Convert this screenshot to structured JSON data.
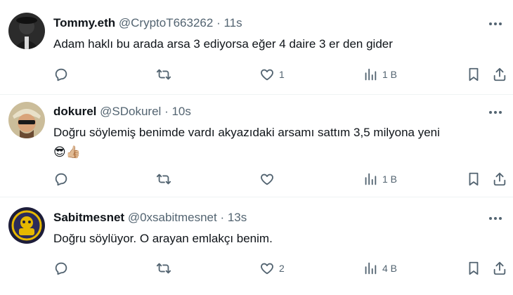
{
  "tweets": [
    {
      "name": "Tommy.eth",
      "handle": "@CryptoT663262",
      "separator": "·",
      "time": "11s",
      "text": "Adam haklı bu arada arsa  3 ediyorsa eğer 4 daire  3 er den gider",
      "emoji": "",
      "replies": "",
      "retweets": "",
      "likes": "1",
      "views": "1 B"
    },
    {
      "name": "dokurel",
      "handle": "@SDokurel",
      "separator": "·",
      "time": "10s",
      "text": "Doğru söylemiş benimde vardı  akyazıdaki arsamı sattım 3,5 milyona yeni",
      "emoji": "😎👍🏼",
      "replies": "",
      "retweets": "",
      "likes": "",
      "views": "1 B"
    },
    {
      "name": "Sabitmesnet",
      "handle": "@0xsabitmesnet",
      "separator": "·",
      "time": "13s",
      "text": "Doğru söylüyor. O arayan emlakçı benim.",
      "emoji": "",
      "replies": "",
      "retweets": "",
      "likes": "2",
      "views": "4 B"
    }
  ],
  "colors": {
    "text": "#0f1419",
    "secondary": "#536471",
    "divider": "#eff3f4"
  },
  "icons": [
    "more-icon",
    "reply-icon",
    "retweet-icon",
    "like-icon",
    "views-icon",
    "bookmark-icon",
    "share-icon"
  ]
}
